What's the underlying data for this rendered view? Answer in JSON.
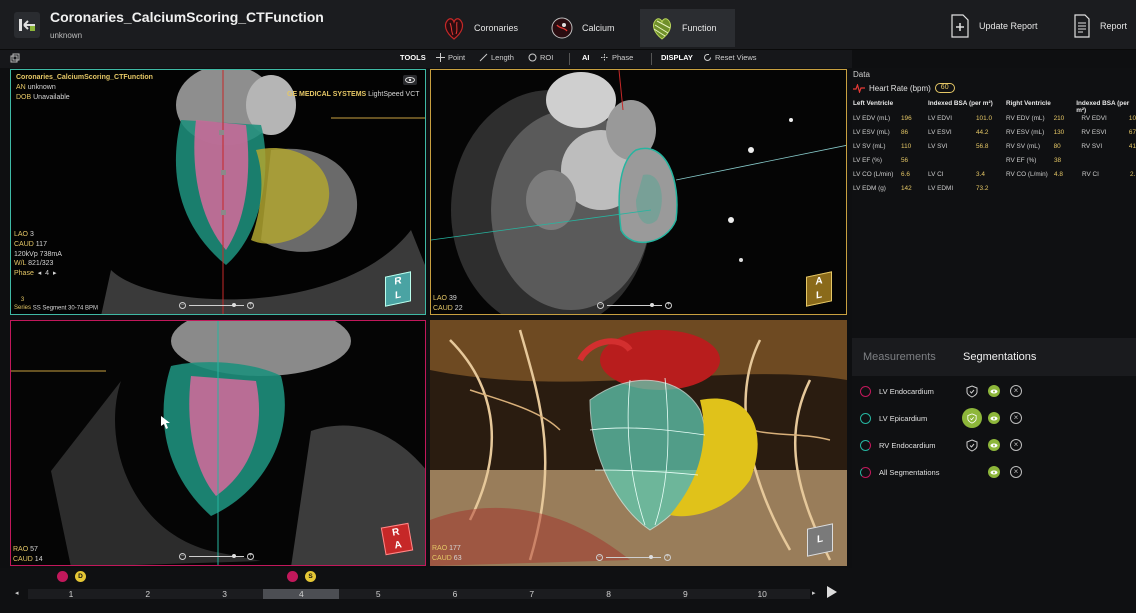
{
  "header": {
    "title": "Coronaries_CalciumScoring_CTFunction",
    "subtitle": "unknown",
    "steps": [
      {
        "label": "Coronaries",
        "active": false
      },
      {
        "label": "Calcium",
        "active": false
      },
      {
        "label": "Function",
        "active": true
      }
    ],
    "update_report": "Update Report",
    "report": "Report"
  },
  "toolbar": {
    "tools_label": "TOOLS",
    "point": "Point",
    "length": "Length",
    "roi": "ROI",
    "ai": "AI",
    "phase": "Phase",
    "display_label": "DISPLAY",
    "reset_views": "Reset Views"
  },
  "viewports": {
    "tl": {
      "series_name": "Coronaries_CalciumScoring_CTFunction",
      "an_label": "AN",
      "an_value": "unknown",
      "dob_label": "DOB",
      "dob_value": "Unavailable",
      "manufacturer": "GE MEDICAL SYSTEMS",
      "model": "LightSpeed VCT",
      "lao_label": "LAO",
      "lao_value": "3",
      "caud_label": "CAUD",
      "caud_value": "117",
      "kvp": "120kVp 738mA",
      "wl_label": "W/L",
      "wl_value": "821/323",
      "phase_label": "Phase",
      "phase_value": "4",
      "series_label": "Series",
      "series_num": "3",
      "series_desc": "SS Segment 30-74 BPM",
      "cube_r": "R",
      "cube_l": "L"
    },
    "tr": {
      "lao_label": "LAO",
      "lao_value": "39",
      "caud_label": "CAUD",
      "caud_value": "22",
      "cube_a": "A",
      "cube_l": "L"
    },
    "bl": {
      "rao_label": "RAO",
      "rao_value": "57",
      "caud_label": "CAUD",
      "caud_value": "14",
      "cube_r": "R",
      "cube_a": "A"
    },
    "br": {
      "rao_label": "RAO",
      "rao_value": "177",
      "caud_label": "CAUD",
      "caud_value": "63",
      "cube_l": "L"
    }
  },
  "data_panel": {
    "title": "Data",
    "heart_rate_label": "Heart Rate (bpm)",
    "heart_rate_value": "60",
    "lv_header": "Left Ventricle",
    "bsa_header": "Indexed BSA (per m²)",
    "rv_header": "Right Ventricle",
    "rv_bsa_header": "Indexed BSA (per m²)",
    "lv_rows": [
      {
        "label": "LV EDV (mL)",
        "value": "196",
        "idx_label": "LV EDVI",
        "idx_value": "101.0"
      },
      {
        "label": "LV ESV (mL)",
        "value": "86",
        "idx_label": "LV ESVI",
        "idx_value": "44.2"
      },
      {
        "label": "LV SV (mL)",
        "value": "110",
        "idx_label": "LV SVI",
        "idx_value": "56.8"
      },
      {
        "label": "LV EF (%)",
        "value": "56",
        "idx_label": "",
        "idx_value": ""
      },
      {
        "label": "LV CO (L/min)",
        "value": "6.6",
        "idx_label": "LV CI",
        "idx_value": "3.4"
      },
      {
        "label": "LV EDM (g)",
        "value": "142",
        "idx_label": "LV EDMI",
        "idx_value": "73.2"
      }
    ],
    "rv_rows": [
      {
        "label": "RV EDV (mL)",
        "value": "210",
        "idx_label": "RV EDVI",
        "idx_value": "10"
      },
      {
        "label": "RV ESV (mL)",
        "value": "130",
        "idx_label": "RV ESVI",
        "idx_value": "67"
      },
      {
        "label": "RV SV (mL)",
        "value": "80",
        "idx_label": "RV SVI",
        "idx_value": "41"
      },
      {
        "label": "RV EF (%)",
        "value": "38",
        "idx_label": "",
        "idx_value": ""
      },
      {
        "label": "RV CO (L/min)",
        "value": "4.8",
        "idx_label": "RV CI",
        "idx_value": "2."
      }
    ]
  },
  "tabs": {
    "measurements": "Measurements",
    "segmentations": "Segmentations"
  },
  "segmentations": [
    {
      "name": "LV Endocardium",
      "color": "#c2185b"
    },
    {
      "name": "LV Epicardium",
      "color": "#26b5a0"
    },
    {
      "name": "RV Endocardium",
      "color": "#26b5a0"
    },
    {
      "name": "All Segmentations",
      "color": "#c2185b"
    }
  ],
  "timeline": {
    "marker_d": "D",
    "marker_s": "S",
    "phases": [
      "1",
      "2",
      "3",
      "4",
      "5",
      "6",
      "7",
      "8",
      "9",
      "10"
    ],
    "selected": "4"
  }
}
